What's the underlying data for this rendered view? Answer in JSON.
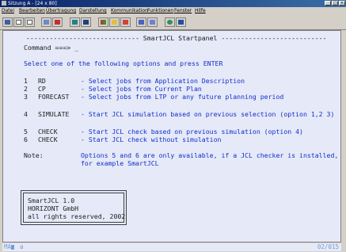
{
  "window": {
    "title": "Sitzung A - [24 x 80]"
  },
  "menu": [
    "Datei",
    "Bearbeiten",
    "Übertragung",
    "Darstellung",
    "Kommunikation",
    "Funktionen",
    "Fenster",
    "Hilfe"
  ],
  "toolbar": {
    "buttons": [
      "new-session",
      "open-session",
      "copy",
      "paste",
      "send",
      "receive",
      "print",
      "color",
      "macro",
      "record",
      "play",
      "help",
      "globe",
      "exit"
    ]
  },
  "terminal": {
    "header": " ----------------------------- SmartJCL Startpanel ---------------------------",
    "command_label": "Command ===> _",
    "instruction": "Select one of the following options and press ENTER",
    "options": [
      {
        "num": "1",
        "name": "RD",
        "desc": "- Select jobs from Application Description"
      },
      {
        "num": "2",
        "name": "CP",
        "desc": "- Select jobs from Current Plan"
      },
      {
        "num": "3",
        "name": "FORECAST",
        "desc": "- Select jobs from LTP or any future planning period"
      },
      {
        "num": "4",
        "name": "SIMULATE",
        "desc": "- Start JCL simulation based on previous selection (option 1,2 3)"
      },
      {
        "num": "5",
        "name": "CHECK",
        "desc": "- Start JCL check based on previous simulation (option 4)"
      },
      {
        "num": "6",
        "name": "CHECK",
        "desc": "- Start JCL check without simulation"
      }
    ],
    "note_label": "Note:",
    "note_line1": "Options 5 and 6 are only available, if a JCL checker is installed,",
    "note_line2": "for example SmartJCL",
    "copyright": [
      "SmartJCL 1.0",
      "HORIZONT GmbH",
      "all rights reserved, 2002"
    ]
  },
  "status": {
    "ma": "MA",
    "indicator": "a",
    "position": "02/015"
  },
  "colors": {
    "screen_bg": "#e6e9f8",
    "terminal_blue": "#1030c8",
    "terminal_dark": "#202020",
    "status_blue": "#6fa0d8"
  }
}
